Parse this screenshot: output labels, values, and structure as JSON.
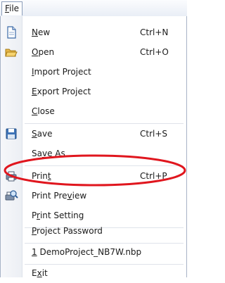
{
  "menubar": {
    "file": {
      "mnemonic": "F",
      "rest": "ile"
    }
  },
  "menu": {
    "items": [
      {
        "key": "new",
        "mn": "N",
        "rest": "ew",
        "shortcut": "Ctrl+N",
        "icon": "new-file-icon"
      },
      {
        "key": "open",
        "mn": "O",
        "rest": "pen",
        "shortcut": "Ctrl+O",
        "icon": "open-folder-icon"
      },
      {
        "key": "import",
        "mn": "I",
        "rest": "mport Project",
        "shortcut": ""
      },
      {
        "key": "export",
        "mn": "E",
        "rest": "xport Project",
        "shortcut": ""
      },
      {
        "key": "close",
        "mn": "C",
        "rest": "lose",
        "shortcut": ""
      },
      {
        "key": "save",
        "mn": "S",
        "rest": "ave",
        "shortcut": "Ctrl+S",
        "icon": "save-disk-icon"
      },
      {
        "key": "saveas",
        "pre": "Sa",
        "mn": "v",
        "rest": "e As",
        "shortcut": ""
      },
      {
        "key": "print",
        "pre": "Prin",
        "mn": "t",
        "rest": "",
        "shortcut": "Ctrl+P",
        "icon": "printer-icon"
      },
      {
        "key": "preview",
        "pre": "Print Pre",
        "mn": "v",
        "rest": "iew",
        "shortcut": "",
        "icon": "print-preview-icon"
      },
      {
        "key": "setting",
        "pre": "P",
        "mn": "r",
        "rest": "int Setting",
        "shortcut": ""
      },
      {
        "key": "password",
        "mn": "P",
        "rest": "roject Password",
        "shortcut": ""
      },
      {
        "key": "recent",
        "mn": "1",
        "rest": " DemoProject_NB7W.nbp",
        "shortcut": ""
      },
      {
        "key": "exit",
        "pre": "E",
        "mn": "x",
        "rest": "it",
        "shortcut": ""
      }
    ]
  },
  "highlight": {
    "target": "print",
    "color": "#e0161e"
  }
}
